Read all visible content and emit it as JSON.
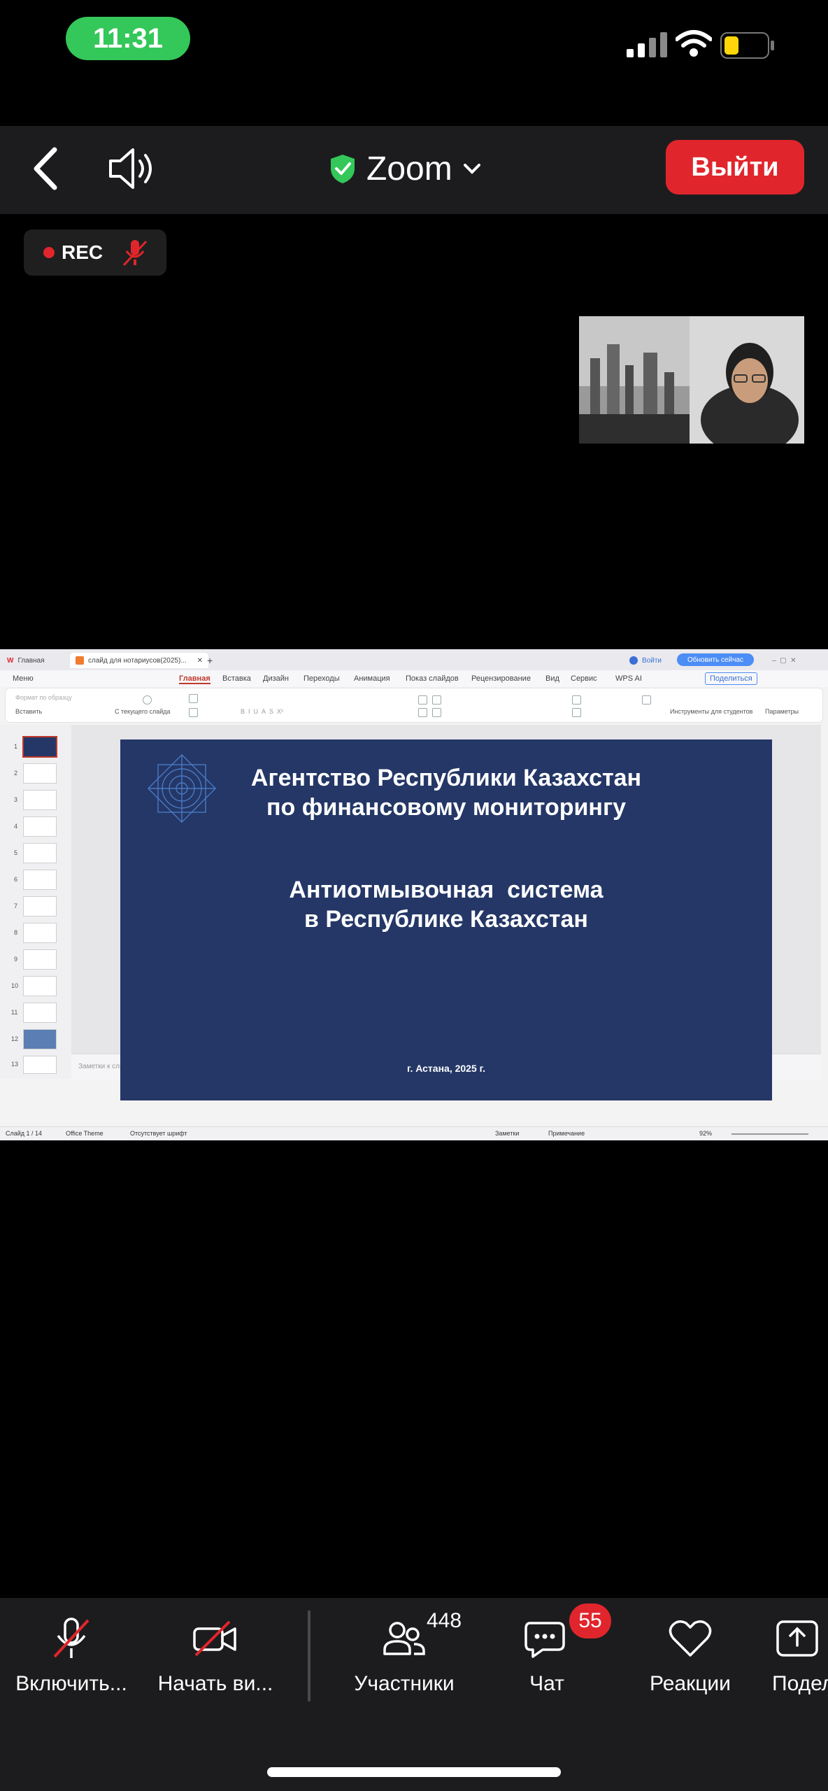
{
  "status_bar": {
    "time": "11:31"
  },
  "toolbar": {
    "title": "Zoom",
    "exit_label": "Выйти"
  },
  "recording": {
    "label": "REC"
  },
  "shared_screen": {
    "tabs": {
      "home": "Главная",
      "document": "слайд для нотариусов(2025)..."
    },
    "header_right": {
      "login": "Войти",
      "upgrade": "Обновить сейчас"
    },
    "menu": [
      "Меню",
      "Главная",
      "Вставка",
      "Дизайн",
      "Переходы",
      "Анимация",
      "Показ слайдов",
      "Рецензирование",
      "Вид",
      "Сервис",
      "WPS AI",
      "Поделиться"
    ],
    "ribbon": {
      "format_painter": "Формат по образцу",
      "paste": "Вставить",
      "from_current": "С текущего слайда",
      "student_tools": "Инструменты для студентов",
      "parameters": "Параметры"
    },
    "slide_numbers": [
      "1",
      "2",
      "3",
      "4",
      "5",
      "6",
      "7",
      "8",
      "9",
      "10",
      "11",
      "12",
      "13"
    ],
    "slide": {
      "line1": "Агентство Республики Казахстан",
      "line2": "по финансовому мониторингу",
      "line3": "Антиотмывочная  система",
      "line4": "в Республике Казахстан",
      "footer": "г. Астана, 2025 г."
    },
    "notes_placeholder": "Заметки к слайду",
    "status": {
      "slide_counter": "Слайд 1 / 14",
      "theme": "Office Theme",
      "font_missing": "Отсутствует шрифт",
      "notes": "Заметки",
      "comments": "Примечание",
      "zoom": "92%"
    }
  },
  "bottom_bar": {
    "items": [
      {
        "label": "Включить...",
        "icon": "muted-mic-icon"
      },
      {
        "label": "Начать ви...",
        "icon": "video-off-icon"
      },
      {
        "label": "Участники",
        "icon": "participants-icon"
      },
      {
        "label": "Чат",
        "icon": "chat-icon"
      },
      {
        "label": "Реакции",
        "icon": "heart-icon"
      },
      {
        "label": "Поделит",
        "icon": "share-icon"
      }
    ],
    "participants_count": "448",
    "chat_badge": "55"
  },
  "colors": {
    "exit_red": "#e0262c",
    "time_pill": "#34c759",
    "slide_bg": "#243767"
  }
}
